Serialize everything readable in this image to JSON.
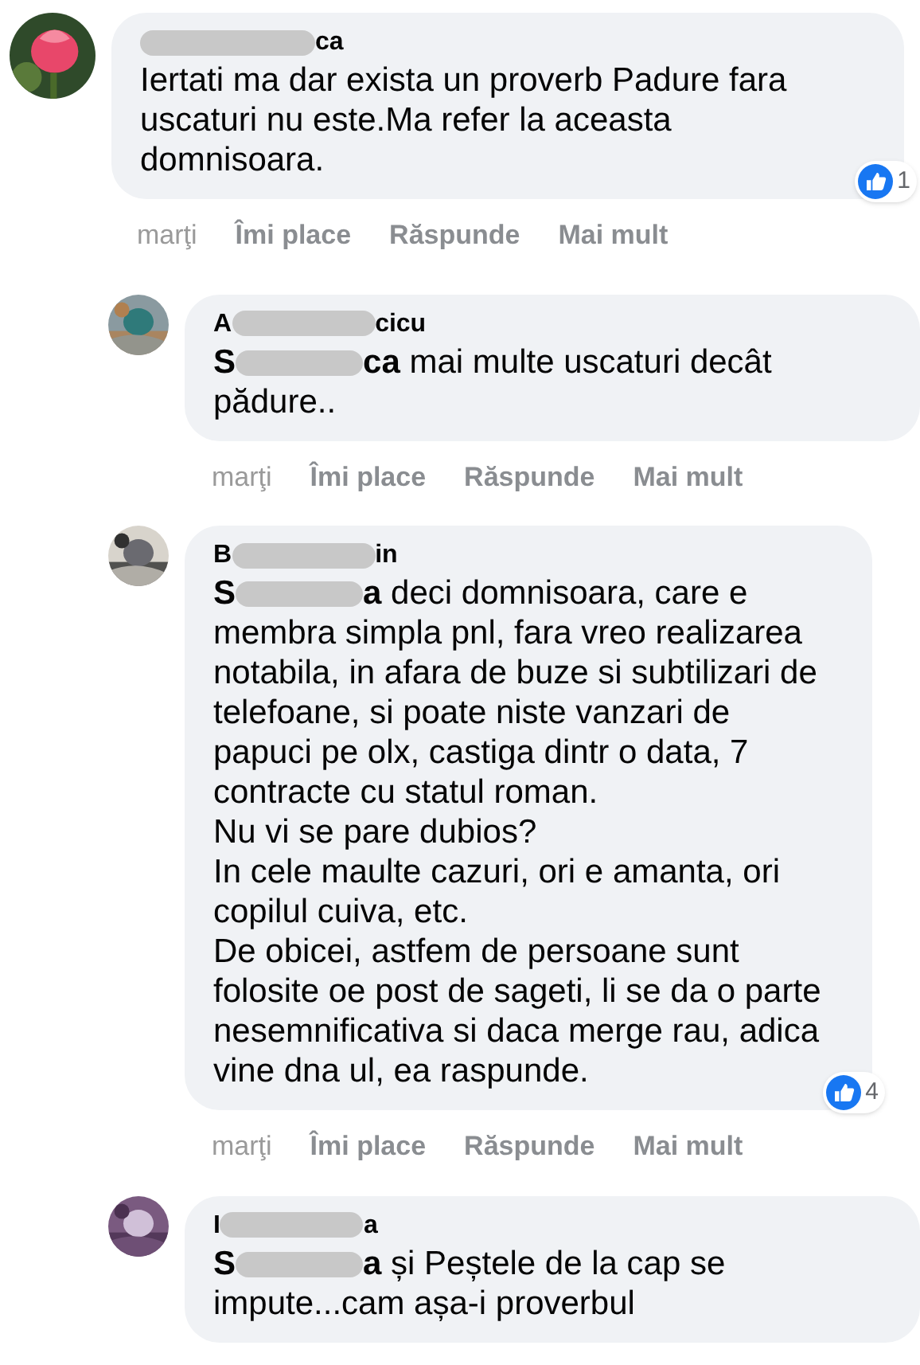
{
  "comments": [
    {
      "author": {
        "after": "ca"
      },
      "paragraphs": [
        "Iertati ma dar exista un proverb Padure fara uscaturi nu este.Ma refer la aceasta domnisoara."
      ],
      "reactions": "1",
      "actions": [
        "marţi",
        "Îmi place",
        "Răspunde",
        "Mai mult"
      ],
      "reply": false
    },
    {
      "author": {
        "before": "A",
        "after": "cicu"
      },
      "mention": {
        "before": "S",
        "after": "ca"
      },
      "paragraphs": [
        "mai multe uscaturi decât pădure.."
      ],
      "actions": [
        "marţi",
        "Îmi place",
        "Răspunde",
        "Mai mult"
      ],
      "reply": true
    },
    {
      "author": {
        "before": "B",
        "after": "in"
      },
      "mention": {
        "before": "S",
        "after": "a"
      },
      "paragraphs": [
        "deci domnisoara, care e membra simpla pnl, fara vreo realizarea notabila, in afara de buze si subtilizari de telefoane, si poate niste vanzari de papuci pe olx, castiga dintr o data, 7 contracte cu statul roman.",
        "Nu vi se pare dubios?",
        "In cele maulte cazuri, ori e amanta, ori copilul cuiva, etc.",
        "De obicei, astfem de persoane sunt folosite oe post de sageti, li se da o parte nesemnificativa si daca merge rau, adica vine dna ul, ea raspunde."
      ],
      "reactions": "4",
      "actions": [
        "marţi",
        "Îmi place",
        "Răspunde",
        "Mai mult"
      ],
      "reply": true
    },
    {
      "author": {
        "before": "I",
        "after": "a"
      },
      "mention": {
        "before": "S",
        "after": "a"
      },
      "paragraphs": [
        "și Peștele de la cap se impute...cam așa-i proverbul"
      ],
      "reply": true
    }
  ]
}
